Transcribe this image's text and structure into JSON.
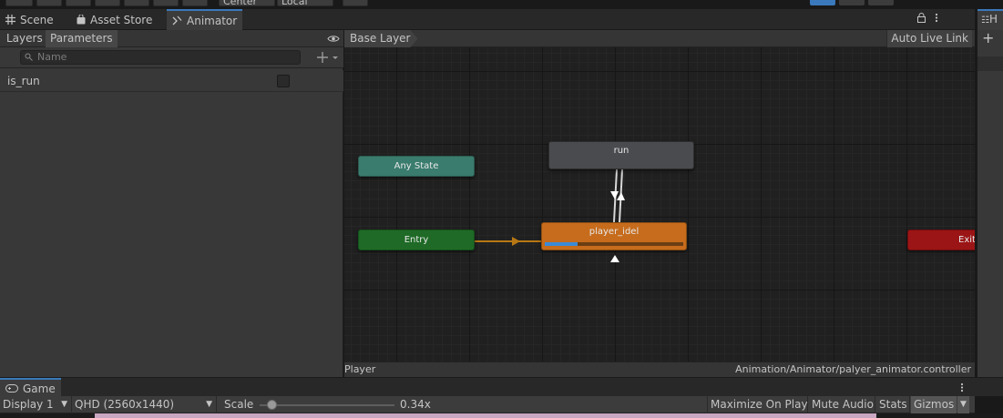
{
  "toolbar": {
    "center_label": "Center",
    "local_label": "Local",
    "colors": {
      "play_active": "#3a79bb"
    }
  },
  "tabs": {
    "scene": "Scene",
    "asset_store": "Asset Store",
    "animator": "Animator"
  },
  "left_panel": {
    "layers_tab": "Layers",
    "parameters_tab": "Parameters",
    "search_placeholder": "Name",
    "parameters": [
      {
        "name": "is_run",
        "type": "bool",
        "value": false
      }
    ]
  },
  "graph": {
    "breadcrumb": "Base Layer",
    "auto_live_link": "Auto Live Link",
    "states": {
      "any_state": "Any State",
      "entry": "Entry",
      "run": "run",
      "player_idel": "player_idel",
      "exit": "Exit"
    },
    "player_idel_progress": 0.24,
    "status_left": "Player",
    "status_right": "Animation/Animator/palyer_animator.controller",
    "colors": {
      "any_state": "#3a7c6e",
      "entry": "#1e6a26",
      "default_state": "#c66c1c",
      "state": "#4a4b4f",
      "exit": "#9c1516",
      "entry_transition": "#b77714"
    }
  },
  "right_panel": {
    "tab_label": "H",
    "add_label": "+"
  },
  "game": {
    "tab_label": "Game",
    "display": "Display 1",
    "resolution": "QHD (2560x1440)",
    "scale_label": "Scale",
    "scale_value": "0.34x",
    "scale_fraction": 0.06,
    "maximize_on_play": "Maximize On Play",
    "mute_audio": "Mute Audio",
    "stats": "Stats",
    "gizmos": "Gizmos"
  }
}
